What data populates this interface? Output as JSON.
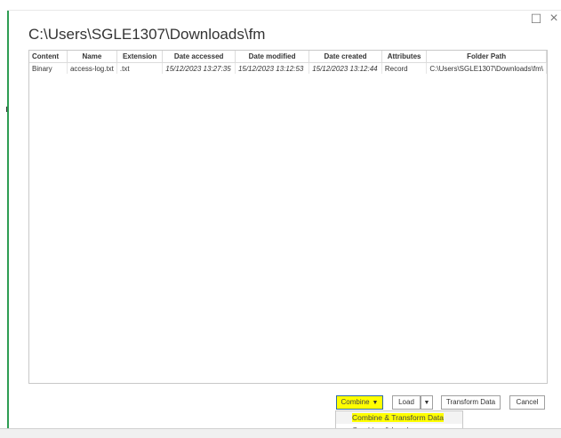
{
  "window": {
    "maximize_glyph": "☐",
    "close_glyph": "×"
  },
  "title": "C:\\Users\\SGLE1307\\Downloads\\fm",
  "table": {
    "columns": [
      "Content",
      "Name",
      "Extension",
      "Date accessed",
      "Date modified",
      "Date created",
      "Attributes",
      "Folder Path"
    ],
    "rows": [
      [
        "Binary",
        "access-log.txt",
        ".txt",
        "15/12/2023 13:27:35",
        "15/12/2023 13:12:53",
        "15/12/2023 13:12:44",
        "Record",
        "C:\\Users\\SGLE1307\\Downloads\\fm\\"
      ]
    ]
  },
  "buttons": {
    "combine": "Combine",
    "combine_arrow": "▼",
    "load": "Load",
    "load_arrow": "▼",
    "transform": "Transform Data",
    "cancel": "Cancel"
  },
  "dropdown": {
    "items": [
      "Combine & Transform Data",
      "Combine & Load"
    ]
  },
  "colors": {
    "highlight": "#ffff00",
    "accent": "#2e9d53"
  }
}
